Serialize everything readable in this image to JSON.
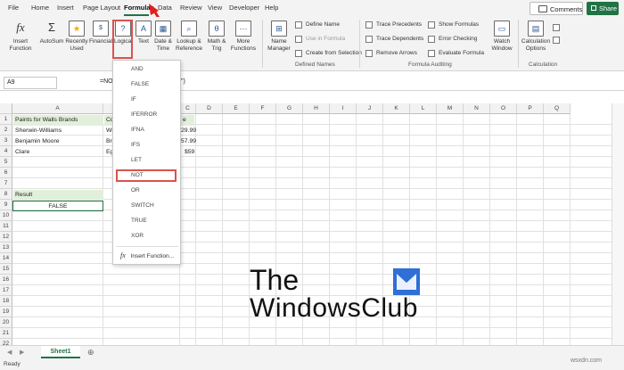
{
  "menu": {
    "tabs": [
      "File",
      "Home",
      "Insert",
      "Page Layout",
      "Formulas",
      "Data",
      "Review",
      "View",
      "Developer",
      "Help"
    ],
    "active": "Formulas",
    "comments": "Comments",
    "share": "Share"
  },
  "ribbon": {
    "insert_function": "Insert Function",
    "fx": "fx",
    "autosum": "AutoSum",
    "recently_used": "Recently Used",
    "financial": "Financial",
    "logical": "Logical",
    "text": "Text",
    "date_time": "Date & Time",
    "lookup_reference": "Lookup & Reference",
    "math_trig": "Math & Trig",
    "more_functions": "More Functions",
    "name_manager": "Name Manager",
    "define_name": "Define Name",
    "use_in_formula": "Use in Formula",
    "create_from_selection": "Create from Selection",
    "defined_names": "Defined Names",
    "trace_precedents": "Trace Precedents",
    "trace_dependents": "Trace Dependents",
    "remove_arrows": "Remove Arrows",
    "show_formulas": "Show Formulas",
    "error_checking": "Error Checking",
    "evaluate_formula": "Evaluate Formula",
    "formula_auditing": "Formula Auditing",
    "watch_window": "Watch Window",
    "calculation_options": "Calculation Options",
    "calculation": "Calculation"
  },
  "formula_bar": {
    "name_box": "A9",
    "formula_start": "=NO",
    "formula_end": "\")"
  },
  "columns": [
    "A",
    "B",
    "C",
    "D",
    "E",
    "F",
    "G",
    "H",
    "I",
    "J",
    "K",
    "L",
    "M",
    "N",
    "O",
    "P",
    "Q"
  ],
  "rows": [
    "1",
    "2",
    "3",
    "4",
    "5",
    "6",
    "7",
    "8",
    "9",
    "10",
    "11",
    "12",
    "13",
    "14",
    "15",
    "16",
    "17",
    "18",
    "19",
    "20",
    "21",
    "22"
  ],
  "cells": {
    "a1": "Paints for Walls Brands",
    "b1": "Col",
    "c1": "e",
    "a2": "Sherwin-Williams",
    "b2": "Wh",
    "c2": "29.99",
    "a3": "Benjamin Moore",
    "b3": "Bro",
    "c3": "57.99",
    "a4": "Clare",
    "b4": "Egg",
    "c4": "$59",
    "a8": "Result",
    "a9": "FALSE"
  },
  "dropdown": {
    "items": [
      "AND",
      "FALSE",
      "IF",
      "IFERROR",
      "IFNA",
      "IFS",
      "LET",
      "NOT",
      "OR",
      "SWITCH",
      "TRUE",
      "XOR"
    ],
    "insert_function": "Insert Function...",
    "fx": "fx"
  },
  "sheet_tabs": [
    "Sheet1"
  ],
  "status": "Ready",
  "watermark": {
    "line1": "The",
    "line2": "WindowsClub",
    "site": "wsxdn.com"
  },
  "colors": {
    "excel_green": "#217346",
    "highlight_red": "#d9534f",
    "header_fill": "#e2efda"
  }
}
